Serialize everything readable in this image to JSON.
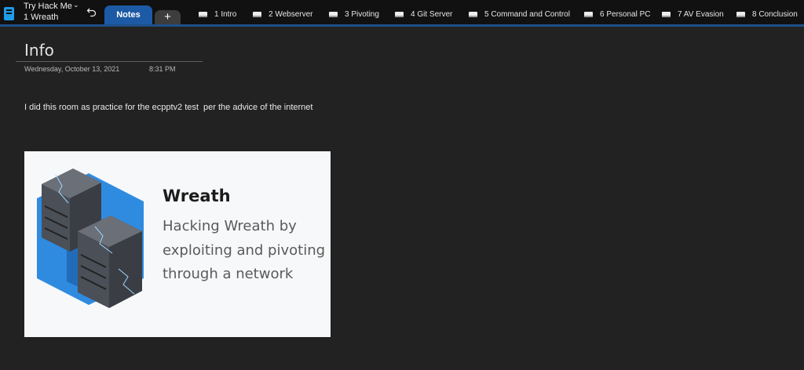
{
  "notebook": {
    "name": "Try Hack Me",
    "current_section": "1 Wreath"
  },
  "tabs": {
    "active": "Notes",
    "add_label": "+"
  },
  "sections": [
    {
      "label": "1 Intro"
    },
    {
      "label": "2 Webserver"
    },
    {
      "label": "3 Pivoting"
    },
    {
      "label": "4 Git Server"
    },
    {
      "label": "5 Command and Control"
    },
    {
      "label": "6 Personal PC"
    },
    {
      "label": "7 AV Evasion"
    },
    {
      "label": "8 Conclusion"
    }
  ],
  "page": {
    "title": "Info",
    "date": "Wednesday, October 13, 2021",
    "time": "8:31 PM",
    "body": "I did this room as practice for the ecpptv2 test  per the advice of the internet"
  },
  "embed": {
    "title": "Wreath",
    "description": "Hacking Wreath by exploiting and pivoting through a network"
  },
  "colors": {
    "accent": "#1d5aa5",
    "notebook_icon": "#1e9be8",
    "background": "#222222",
    "topbar": "#111111"
  }
}
